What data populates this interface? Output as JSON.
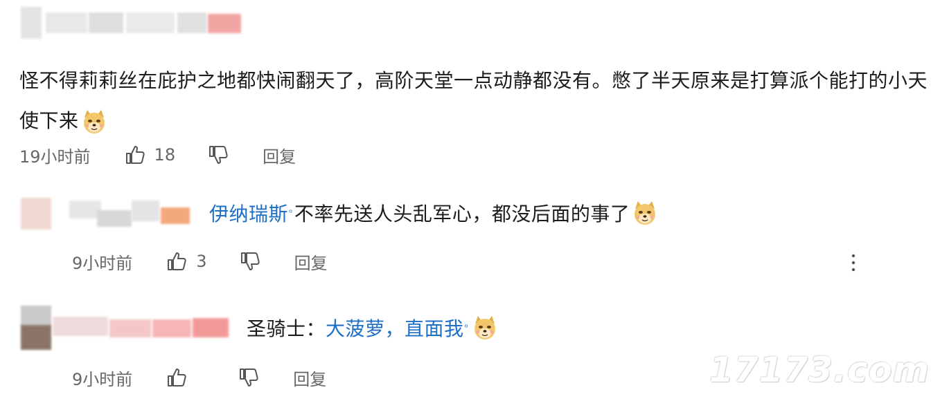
{
  "comment": {
    "text": "怪不得莉莉丝在庇护之地都快闹翻天了，高阶天堂一点动静都没有。憋了半天原来是打算派个能打的小天使下来",
    "emoji": "doge-emoji",
    "time": "19小时前",
    "likes": "18",
    "reply_label": "回复"
  },
  "replies": [
    {
      "mention": "伊纳瑞斯",
      "text": "不率先送人头乱军心，都没后面的事了",
      "emoji": "doge-emoji",
      "time": "9小时前",
      "likes": "3",
      "reply_label": "回复",
      "more_icon": "more-vertical-icon"
    },
    {
      "prefix": "圣骑士：",
      "mention": "大菠萝，直面我",
      "emoji": "doge-emoji",
      "time": "9小时前",
      "likes": "",
      "reply_label": "回复"
    }
  ],
  "watermark": "17173.com",
  "colors": {
    "link": "#1f6fc7",
    "meta": "#666666",
    "text": "#1c1c1c"
  }
}
